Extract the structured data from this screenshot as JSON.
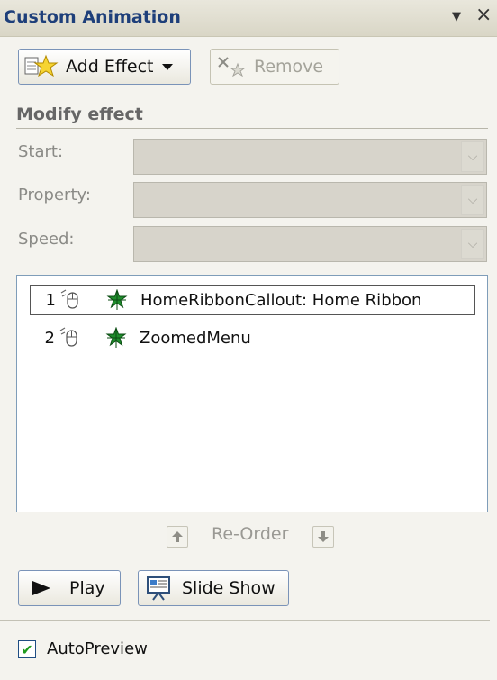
{
  "panel": {
    "title": "Custom Animation",
    "menu_glyph": "▼",
    "close_glyph": "×"
  },
  "toolbar": {
    "add_effect_label": "Add Effect",
    "remove_label": "Remove"
  },
  "modify": {
    "section_label": "Modify effect",
    "fields": [
      {
        "label": "Start:",
        "value": ""
      },
      {
        "label": "Property:",
        "value": ""
      },
      {
        "label": "Speed:",
        "value": ""
      }
    ]
  },
  "animation_list": {
    "items": [
      {
        "number": "1",
        "text": "HomeRibbonCallout: Home Ribbon",
        "selected": true
      },
      {
        "number": "2",
        "text": "ZoomedMenu",
        "selected": false
      }
    ]
  },
  "reorder": {
    "label": "Re-Order"
  },
  "playback": {
    "play_label": "Play",
    "slideshow_label": "Slide Show"
  },
  "autopreview": {
    "label": "AutoPreview",
    "checked": true
  },
  "colors": {
    "title_text": "#1e3f7a",
    "list_border": "#7f9db9",
    "star_green": "#1e8c2b",
    "check_green": "#1e9a1e"
  }
}
